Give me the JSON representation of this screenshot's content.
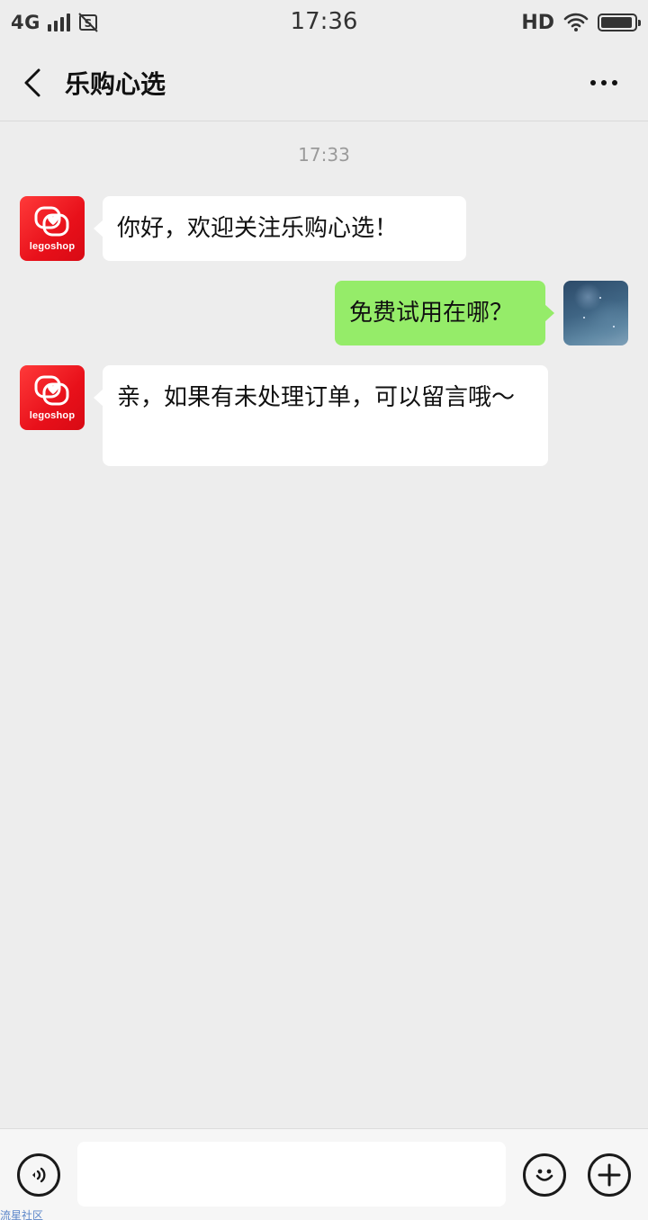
{
  "status_bar": {
    "network": "4G",
    "time": "17:36",
    "hd": "HD"
  },
  "nav": {
    "title": "乐购心选"
  },
  "chat": {
    "timestamp": "17:33",
    "messages": [
      {
        "from": "brand",
        "text": "你好，欢迎关注乐购心选！"
      },
      {
        "from": "me",
        "text": "免费试用在哪？"
      },
      {
        "from": "brand",
        "text": "亲，如果有未处理订单，可以留言哦～"
      }
    ],
    "brand_avatar_text": "legoshop"
  },
  "input_bar": {
    "value": ""
  },
  "watermark": "流星社区",
  "colors": {
    "background": "#ededed",
    "incoming_bubble": "#ffffff",
    "outgoing_bubble": "#95ec69",
    "brand_red": "#e8101a"
  },
  "icons": {
    "back": "chevron-left-icon",
    "more": "more-dots-icon",
    "voice": "voice-icon",
    "emoji": "emoji-icon",
    "add": "plus-icon"
  }
}
